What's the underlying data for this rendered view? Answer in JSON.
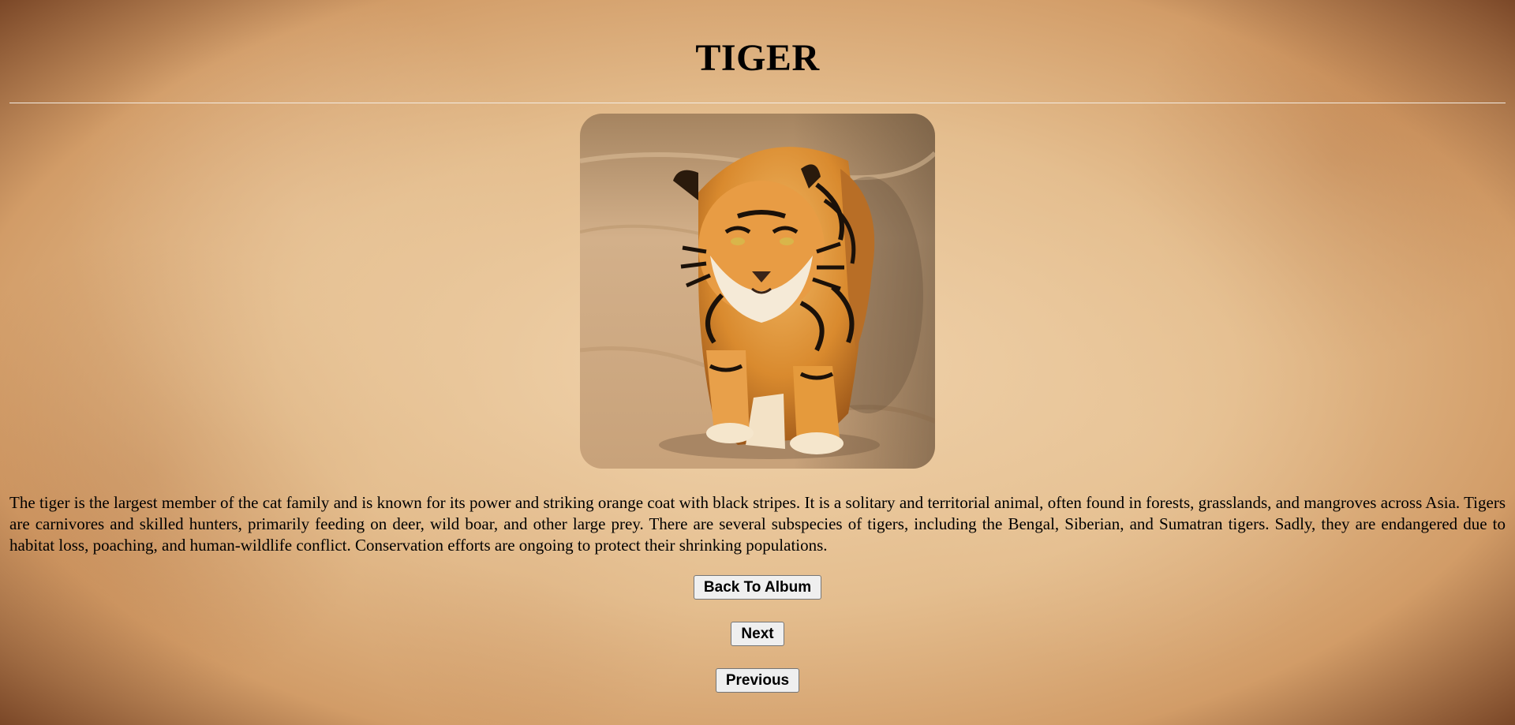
{
  "page": {
    "title": "TIGER",
    "description": "The tiger is the largest member of the cat family and is known for its power and striking orange coat with black stripes. It is a solitary and territorial animal, often found in forests, grasslands, and mangroves across Asia. Tigers are carnivores and skilled hunters, primarily feeding on deer, wild boar, and other large prey. There are several subspecies of tigers, including the Bengal, Siberian, and Sumatran tigers. Sadly, they are endangered due to habitat loss, poaching, and human-wildlife conflict. Conservation efforts are ongoing to protect their shrinking populations."
  },
  "buttons": {
    "back": "Back To Album",
    "next": "Next",
    "previous": "Previous"
  },
  "colors": {
    "background": "#d9ab78",
    "rule": "#f4ece2",
    "button_bg": "#efefef"
  }
}
